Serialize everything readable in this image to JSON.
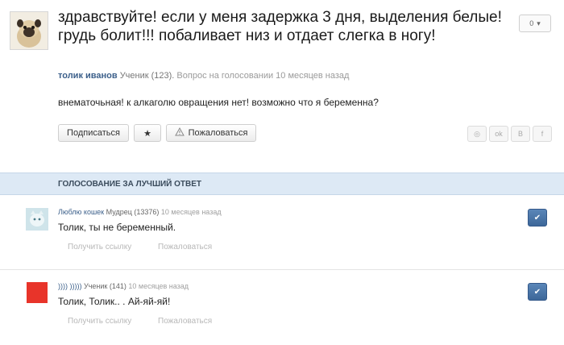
{
  "question": {
    "title": "здравствуйте! если у меня задержка 3 дня, выделения белые! грудь болит!!! побаливает низ и отдает слегка в ногу!",
    "author": "толик иванов",
    "rank": "Ученик (123).",
    "meta_text": "Вопрос на голосовании 10 месяцев назад",
    "body": "внематочьная! к алкаголю овращения нет! возможно что я беременна?",
    "vote_count": "0"
  },
  "actions": {
    "subscribe_label": "Подписаться",
    "star_label": "★",
    "complain_label": "Пожаловаться"
  },
  "share": {
    "items": [
      "◎",
      "ok",
      "B",
      "f"
    ]
  },
  "section": {
    "title": "ГОЛОСОВАНИЕ ЗА ЛУЧШИЙ ОТВЕТ"
  },
  "answers": [
    {
      "author": "Люблю кошек",
      "rank": "Мудрец (13376)",
      "time": "10 месяцев назад",
      "text": "Толик, ты не беременный.",
      "link_label": "Получить ссылку",
      "complain_label": "Пожаловаться",
      "avatar_color": "#cfe4ea"
    },
    {
      "author": ")))) )))))",
      "rank": "Ученик (141)",
      "time": "10 месяцев назад",
      "text": "Толик, Толик.. . Ай-яй-яй!",
      "link_label": "Получить ссылку",
      "complain_label": "Пожаловаться",
      "avatar_color": "#e8342a"
    }
  ],
  "colors": {
    "accent": "#3d6799",
    "section_bg": "#dde9f5",
    "author_link": "#3b5f8a"
  }
}
